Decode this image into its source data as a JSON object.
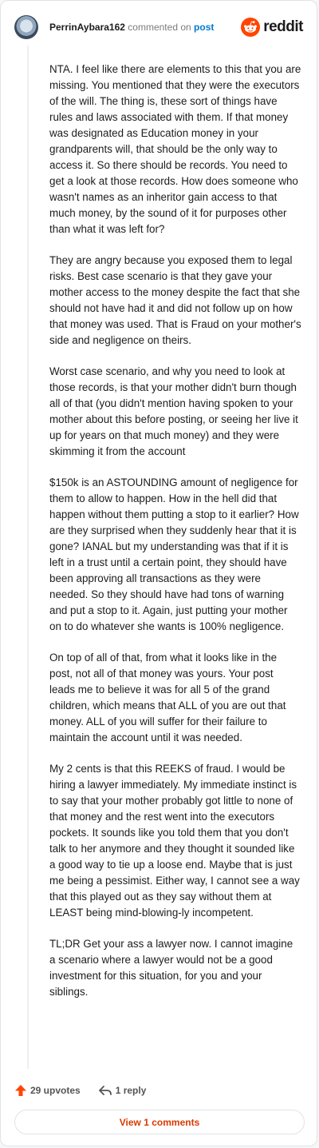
{
  "header": {
    "username": "PerrinAybara162",
    "action_text": "commented on",
    "post_link": "post",
    "brand": "reddit"
  },
  "comment": {
    "paragraphs": [
      "NTA. I feel like there are elements to this that you are missing. You mentioned that they were the executors of the will. The thing is, these sort of things have rules and laws associated with them. If that money was designated as Education money in your grandparents will, that should be the only way to access it. So there should be records. You need to get a look at those records. How does someone who wasn't names as an inheritor gain access to that much money, by the sound of it for purposes other than what it was left for?",
      "They are angry because you exposed them to legal risks. Best case scenario is that they gave your mother access to the money despite the fact that she should not have had it and did not follow up on how that money was used. That is Fraud on your mother's side and negligence on theirs.",
      "Worst case scenario, and why you need to look at those records, is that your mother didn't burn though all of that (you didn't mention having spoken to your mother about this before posting, or seeing her live it up for years on that much money) and they were skimming it from the account",
      "$150k is an ASTOUNDING amount of negligence for them to allow to happen. How in the hell did that happen without them putting a stop to it earlier? How are they surprised when they suddenly hear that it is gone? IANAL but my understanding was that if it is left in a trust until a certain point, they should have been approving all transactions as they were needed. So they should have had tons of warning and put a stop to it. Again, just putting your mother on to do whatever she wants is 100% negligence.",
      "On top of all of that, from what it looks like in the post, not all of that money was yours. Your post leads me to believe it was for all 5 of the grand children, which means that ALL of you are out that money. ALL of you will suffer for their failure to maintain the account until it was needed.",
      "My 2 cents is that this REEKS of fraud. I would be hiring a lawyer immediately. My immediate instinct is to say that your mother probably got little to none of that money and the rest went into the executors pockets. It sounds like you told them that you don't talk to her anymore and they thought it sounded like a good way to tie up a loose end. Maybe that is just me being a pessimist. Either way, I cannot see a way that this played out as they say without them at LEAST being mind-blowing-ly incompetent.",
      "TL;DR Get your ass a lawyer now. I cannot imagine a scenario where a lawyer would not be a good investment for this situation, for you and your siblings."
    ]
  },
  "actions": {
    "upvotes": "29 upvotes",
    "reply": "1 reply",
    "view_comments": "View 1 comments"
  },
  "icons": {
    "avatar": "avatar-image",
    "brand": "reddit-logo-icon",
    "upvote": "upvote-arrow-icon",
    "reply": "reply-arrow-icon"
  },
  "colors": {
    "brand_orange": "#ff4500",
    "link_blue": "#0079d3",
    "view_button_text": "#d93a00"
  }
}
